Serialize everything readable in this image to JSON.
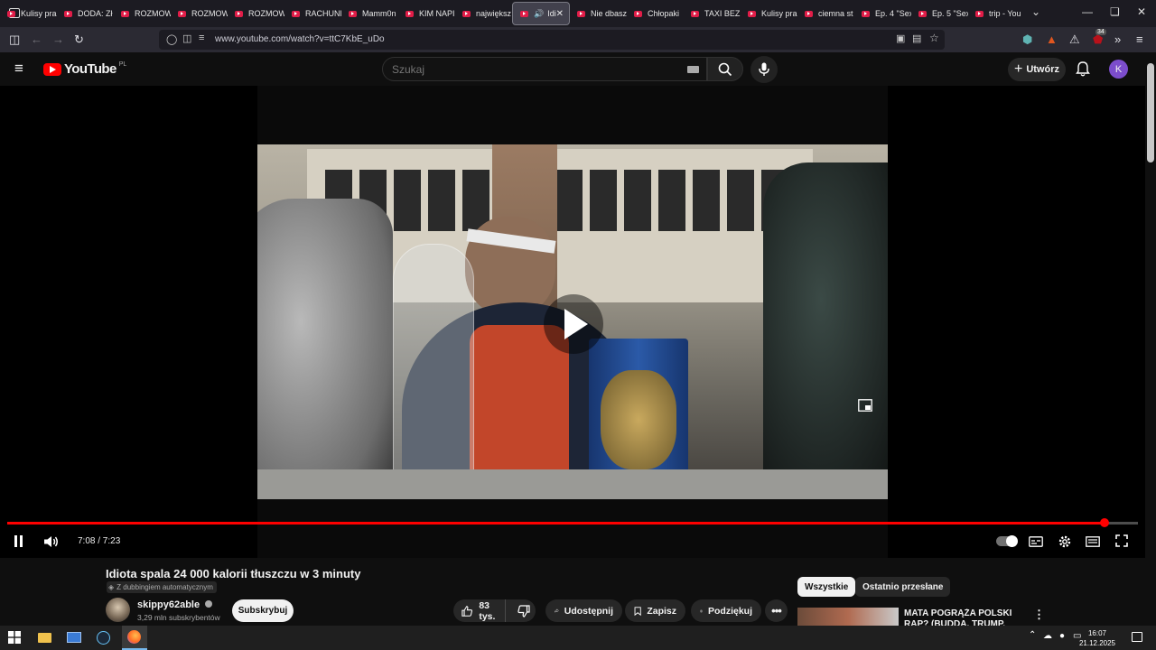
{
  "browser": {
    "tabs": [
      {
        "label": "Kulisy pra",
        "active": false
      },
      {
        "label": "DODA: Zł",
        "active": false
      },
      {
        "label": "ROZMOW",
        "active": false
      },
      {
        "label": "ROZMOW",
        "active": false
      },
      {
        "label": "ROZMOW",
        "active": false
      },
      {
        "label": "RACHUNE",
        "active": false
      },
      {
        "label": "Mamm0n",
        "active": false
      },
      {
        "label": "KIM NAPI",
        "active": false
      },
      {
        "label": "największ",
        "active": false
      },
      {
        "label": "Idi",
        "active": true,
        "audio": true
      },
      {
        "label": "Nie dbasz",
        "active": false
      },
      {
        "label": "Chłopaki",
        "active": false
      },
      {
        "label": "TAXI BEZ",
        "active": false
      },
      {
        "label": "Kulisy pra",
        "active": false
      },
      {
        "label": "ciemna st",
        "active": false
      },
      {
        "label": "Ep. 4 \"Sex",
        "active": false
      },
      {
        "label": "Ep. 5 \"Sex",
        "active": false
      },
      {
        "label": "trip - You",
        "active": false
      }
    ],
    "url": "www.youtube.com/watch?v=ttC7KbE_uDo",
    "extension_badge": "34"
  },
  "youtube": {
    "logo_text": "YouTube",
    "region": "PL",
    "search_placeholder": "Szukaj",
    "create_label": "Utwórz",
    "avatar_letter": "K"
  },
  "player": {
    "time_display": "7:08 / 7:23",
    "progress_fraction": 0.9706,
    "state": "paused"
  },
  "video": {
    "title": "Idiota spala 24 000 kalorii tłuszczu w 3 minuty",
    "dubbing_badge": "Z dubbingiem automatycznym",
    "channel_name": "skippy62able",
    "subscribers": "3,29 mln subskrybentów",
    "subscribe_label": "Subskrybuj",
    "likes": "83 tys.",
    "share_label": "Udostępnij",
    "save_label": "Zapisz",
    "thanks_label": "Podziękuj"
  },
  "recommendations": {
    "chips": [
      "Wszystkie",
      "Ostatnio przesłane"
    ],
    "first_title": "MATA POGRĄŻA POLSKI RAP? (BUDDA, TRUMP, AKTA"
  },
  "taskbar": {
    "time": "16:07",
    "date": "21.12.2025"
  },
  "colors": {
    "youtube_red": "#ff0000",
    "background": "#0f0f0f",
    "avatar": "#7c4dcc"
  }
}
